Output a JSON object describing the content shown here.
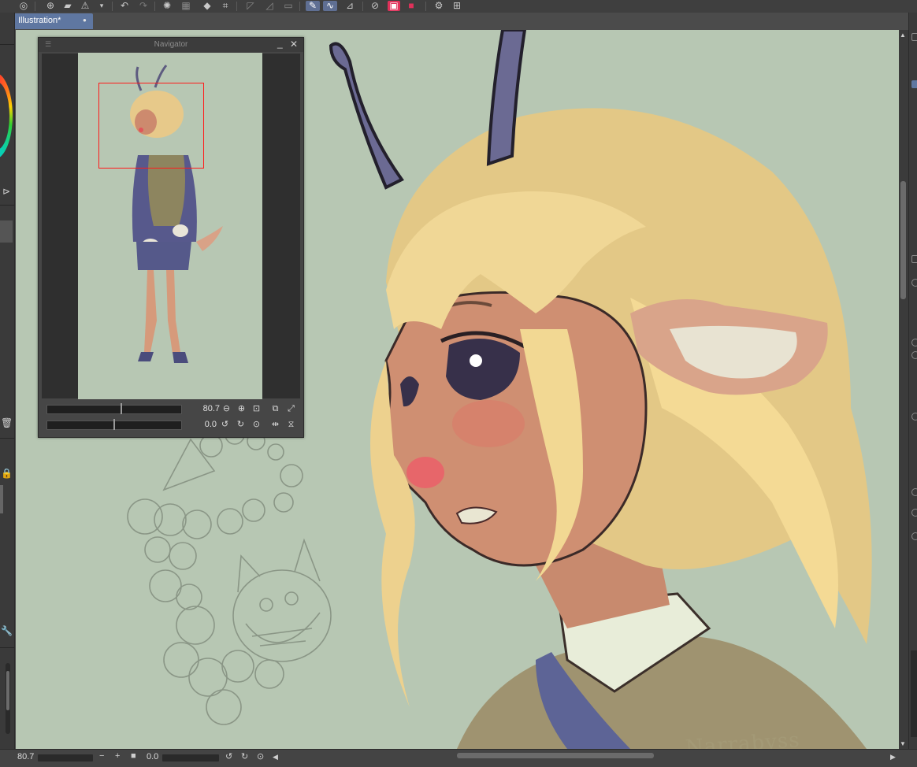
{
  "document": {
    "tab_title": "Illustration*",
    "tab_modified_dot": "●"
  },
  "toolbar": {
    "icons": [
      "app-logo-icon",
      "new-document-icon",
      "open-folder-icon",
      "warning-icon",
      "dropdown-icon",
      "undo-icon",
      "redo-icon",
      "loading-icon",
      "transform-icon",
      "fill-icon",
      "crop-icon",
      "selection-tool-icon",
      "lasso-icon",
      "select-all-icon",
      "pen-active-icon",
      "brush-active-icon",
      "snap-icon",
      "color-record-icon",
      "red-square-icon",
      "settings-icon",
      "adjust-icon"
    ]
  },
  "canvas": {
    "background_color": "#b7c7b3",
    "signature_text": "Narrabyss"
  },
  "navigator": {
    "title": "Navigator",
    "zoom_value": "80.7",
    "rotation_value": "0.0",
    "view_rect_color": "#ff1a1a"
  },
  "statusbar": {
    "zoom_value": "80.7",
    "rotation_value": "0.0"
  },
  "colors": {
    "accent_tab": "#5f77a1",
    "panel_bg": "#464646",
    "ui_bg": "#4b4b4b"
  }
}
